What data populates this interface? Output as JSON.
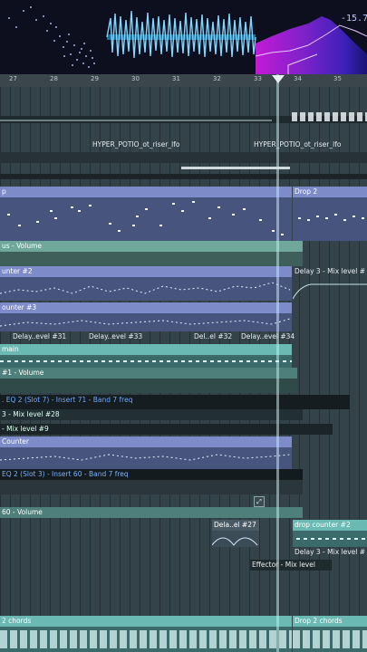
{
  "visualizer": {
    "readout": "-15.7"
  },
  "ruler": {
    "bars": [
      "27",
      "28",
      "29",
      "30",
      "31",
      "32",
      "33",
      "34",
      "35"
    ]
  },
  "clips": {
    "riser_lfo_1": "HYPER_POTIO_ot_riser_lfo",
    "riser_lfo_2": "HYPER_POTIO_ot_riser_lfo",
    "drop_left": "p",
    "drop_right": "Drop 2",
    "bus_volume": "us - Volume",
    "counter2": "unter #2",
    "delay3_mix_a": "Delay 3 - Mix level #",
    "counter3": "ounter #3",
    "delay_evel31": "Delay..evel #31",
    "delay_evel33": "Delay..evel #33",
    "del_el32": "Del..el #32",
    "delay_evel34": "Delay..evel #34",
    "main": "main",
    "one_volume": "#1 - Volume",
    "eq2_slot7": ". EQ 2 (Slot 7) - Insert 71 - Band 7 freq",
    "three_mix28": "3 - Mix level #28",
    "mix9": "- Mix level #9",
    "counter": "Counter",
    "eq2_slot3": "EQ 2 (Slot 3) - Insert 60 - Band 7 freq",
    "sixty_volume": "60 - Volume",
    "dela_el27": "Dela..el #27",
    "drop_counter2": "drop counter #2",
    "delay3_mix_b": "Delay 3 - Mix level #",
    "effector_mix": "Effector - Mix level",
    "chords_left": "2 chords",
    "chords_right": "Drop 2 chords"
  },
  "colors": {
    "clip_header_blue": "#7d8cc9",
    "clip_header_teal": "#6bb9b3",
    "clip_header_dark_teal": "#4f7f7a",
    "automation_green": "#6fa89a",
    "background": "#34424a"
  }
}
